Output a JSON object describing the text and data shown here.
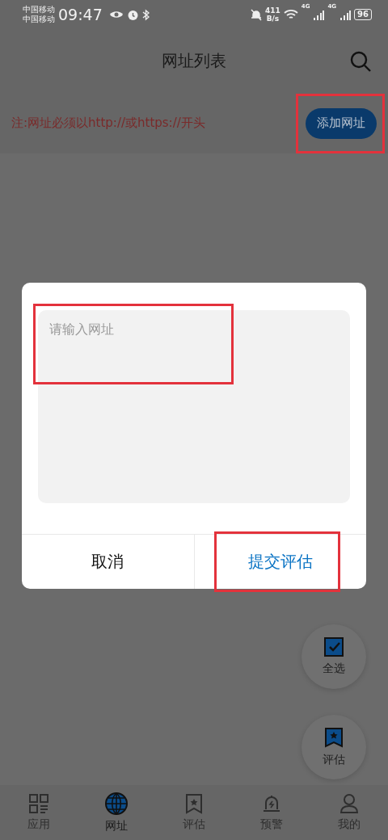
{
  "status_bar": {
    "carriers": [
      "中国移动",
      "中国移动"
    ],
    "time": "09:47",
    "speed_value": "411",
    "speed_unit": "B/s",
    "network_labels": [
      "4G",
      "4G"
    ],
    "battery": "96"
  },
  "header": {
    "title": "网址列表"
  },
  "notice": {
    "text": "注:网址必须以http://或https://开头",
    "add_button": {
      "label": "添加网址",
      "highlighted": true
    }
  },
  "dialog": {
    "input": {
      "placeholder": "请输入网址",
      "highlighted": true
    },
    "buttons": [
      {
        "label": "取消",
        "kind": "cancel",
        "highlighted": false
      },
      {
        "label": "提交评估",
        "kind": "confirm",
        "highlighted": true
      }
    ]
  },
  "fabs": [
    {
      "label": "全选",
      "kind": "select-all"
    },
    {
      "label": "评估",
      "kind": "evaluate"
    }
  ],
  "bottom_nav": [
    {
      "label": "应用",
      "kind": "apps",
      "selected": false
    },
    {
      "label": "网址",
      "kind": "globe",
      "selected": true
    },
    {
      "label": "评估",
      "kind": "evaluate",
      "selected": false
    },
    {
      "label": "预警",
      "kind": "alert",
      "selected": false
    },
    {
      "label": "我的",
      "kind": "profile",
      "selected": false
    }
  ]
}
